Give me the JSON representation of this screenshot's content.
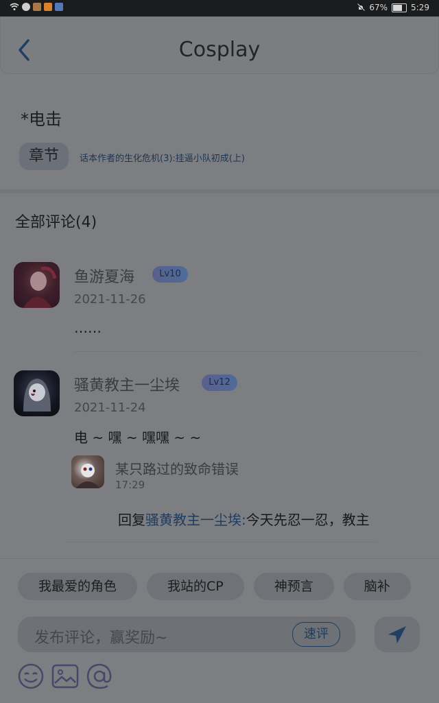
{
  "status_bar": {
    "battery": "67%",
    "time": "5:29",
    "battery_level": 0.67
  },
  "header": {
    "title": "Cosplay"
  },
  "post": {
    "title": "*电击",
    "chapter_tag": "章节",
    "chapter_link": "话本作者的生化危机(3):挂逼小队初成(上)"
  },
  "comments_section": {
    "header": "全部评论(4)",
    "comments": [
      {
        "username": "鱼游夏海",
        "level": "Lv10",
        "date": "2021-11-26",
        "text": "……"
      },
      {
        "username": "骚黄教主一尘埃",
        "level": "Lv12",
        "date": "2021-11-24",
        "text": "电 ~ 嘿 ~ 嘿嘿 ~ ~",
        "reply": {
          "username": "某只路过的致命错误",
          "time": "17:29",
          "prefix": "回复",
          "mention": "骚黄教主一尘埃:",
          "text": "今天先忍一忍，教主"
        }
      }
    ]
  },
  "bottom": {
    "chips": [
      "我最爱的角色",
      "我站的CP",
      "神预言",
      "脑补"
    ],
    "input_placeholder": "发布评论，赢奖励~",
    "quick_review": "速评"
  },
  "colors": {
    "accent": "#1f3f63",
    "overlay": "#7c7e81"
  }
}
